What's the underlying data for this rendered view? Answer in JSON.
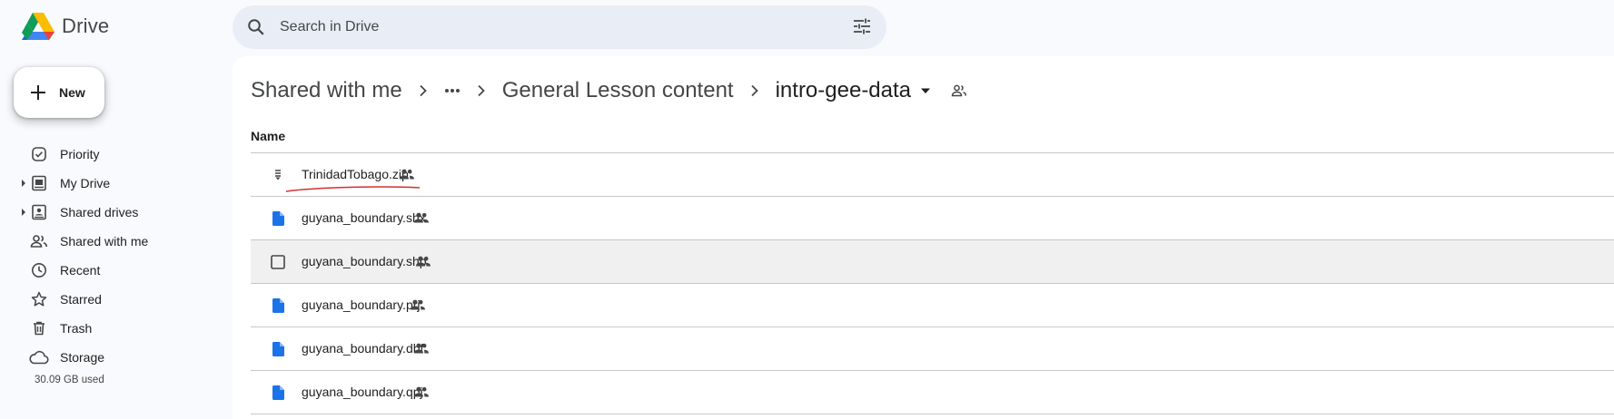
{
  "app": {
    "name": "Drive"
  },
  "search": {
    "placeholder": "Search in Drive"
  },
  "sidebar": {
    "new_label": "New",
    "items": [
      {
        "label": "Priority",
        "icon": "priority-icon",
        "expandable": false
      },
      {
        "label": "My Drive",
        "icon": "my-drive-icon",
        "expandable": true
      },
      {
        "label": "Shared drives",
        "icon": "shared-drives-icon",
        "expandable": true
      },
      {
        "label": "Shared with me",
        "icon": "shared-with-me-icon",
        "expandable": false
      },
      {
        "label": "Recent",
        "icon": "clock-icon",
        "expandable": false
      },
      {
        "label": "Starred",
        "icon": "star-icon",
        "expandable": false
      },
      {
        "label": "Trash",
        "icon": "trash-icon",
        "expandable": false
      },
      {
        "label": "Storage",
        "icon": "cloud-icon",
        "expandable": false
      }
    ],
    "storage_used": "30.09 GB used"
  },
  "breadcrumb": {
    "root": "Shared with me",
    "middle": "General Lesson content",
    "current": "intro-gee-data"
  },
  "table": {
    "column_name": "Name",
    "files": [
      {
        "name": "TrinidadTobago.zip",
        "icon": "zip-file-icon",
        "shared": true,
        "annotated": true
      },
      {
        "name": "guyana_boundary.shx",
        "icon": "doc-file-icon",
        "shared": true
      },
      {
        "name": "guyana_boundary.shp",
        "icon": "checkbox-icon",
        "shared": true,
        "hover": true
      },
      {
        "name": "guyana_boundary.prj",
        "icon": "doc-file-icon",
        "shared": true
      },
      {
        "name": "guyana_boundary.dbf",
        "icon": "doc-file-icon",
        "shared": true
      },
      {
        "name": "guyana_boundary.qpj",
        "icon": "doc-file-icon",
        "shared": true
      }
    ]
  },
  "colors": {
    "accent_blue": "#1a73e8",
    "annotation_red": "#d32f2f",
    "search_bg": "#e9eef6"
  }
}
